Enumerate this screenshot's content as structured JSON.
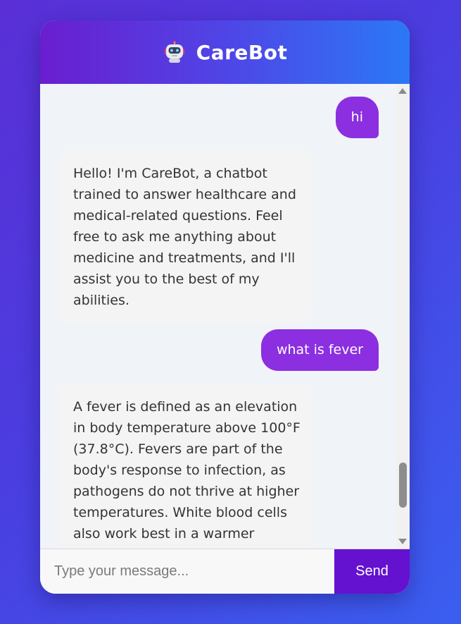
{
  "header": {
    "title": "CareBot",
    "icon": "robot-icon"
  },
  "messages": [
    {
      "sender": "user",
      "text": "hi"
    },
    {
      "sender": "bot",
      "text": "Hello! I'm CareBot, a chatbot trained to answer healthcare and medical-related questions. Feel free to ask me anything about medicine and treatments, and I'll assist you to the best of my abilities."
    },
    {
      "sender": "user",
      "text": "what is fever"
    },
    {
      "sender": "bot",
      "text": "A fever is defined as an elevation in body temperature above 100°F (37.8°C). Fevers are part of the body's response to infection, as pathogens do not thrive at higher temperatures. White blood cells also work best in a warmer environment. Under that"
    }
  ],
  "input": {
    "placeholder": "Type your message...",
    "value": ""
  },
  "send_label": "Send",
  "colors": {
    "header_start": "#6a1ed0",
    "header_end": "#2b78f6",
    "user_bubble": "#8b2fe0",
    "bot_bubble": "#f4f4f5",
    "send_button": "#6511d0"
  }
}
